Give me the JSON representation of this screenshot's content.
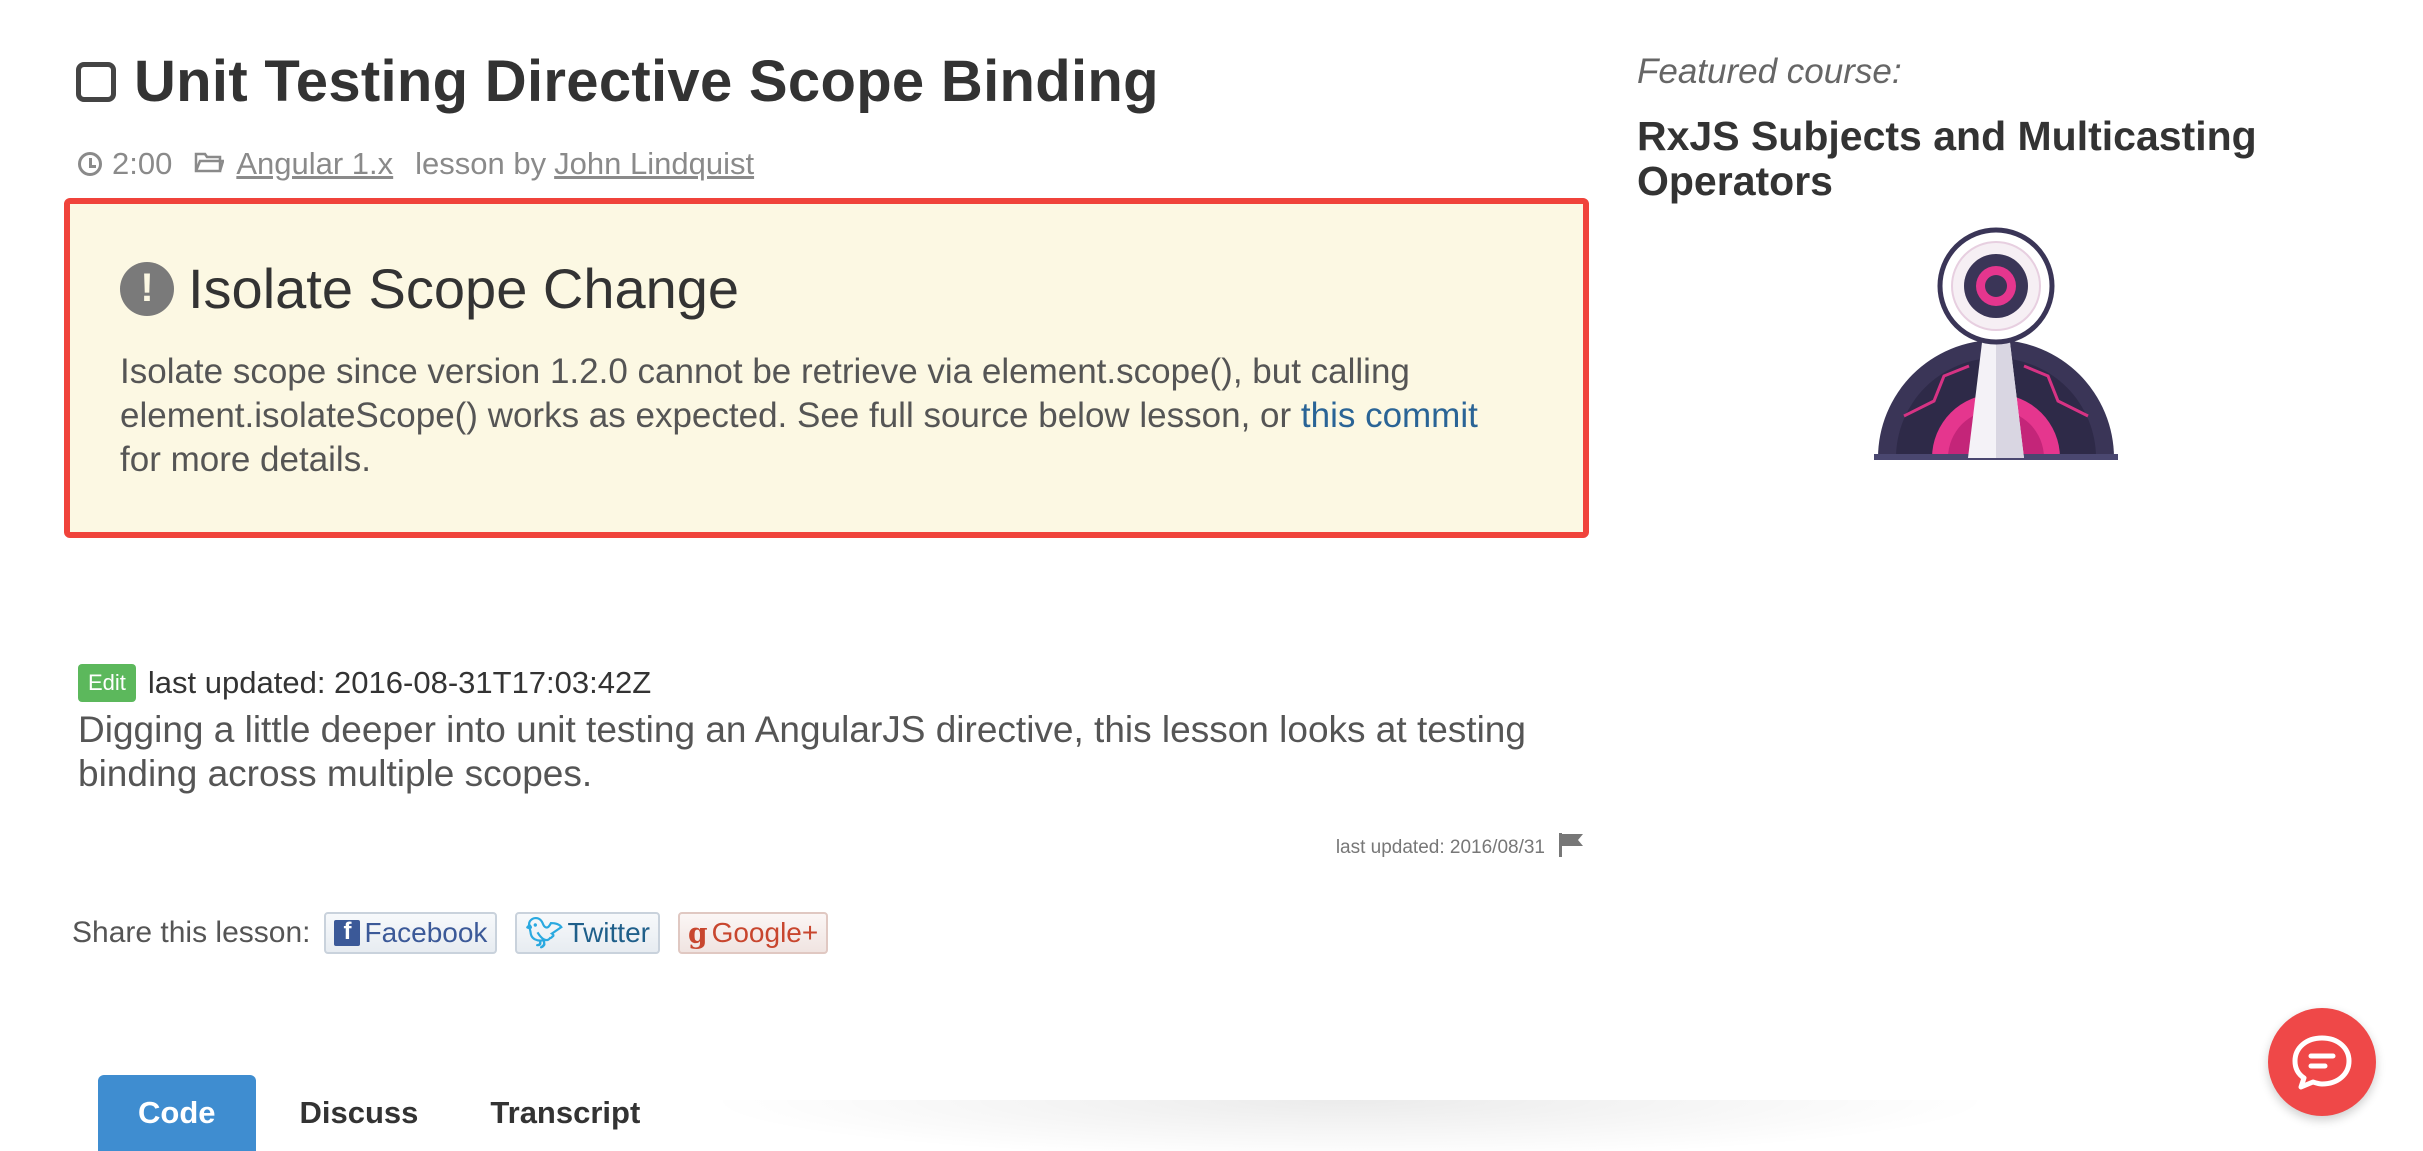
{
  "lesson": {
    "title": "Unit Testing Directive Scope Binding",
    "duration": "2:00",
    "category_link": "Angular 1.x",
    "lesson_by_text": "lesson by",
    "author_link": "John Lindquist"
  },
  "alert": {
    "heading": "Isolate Scope Change",
    "body_before_link": "Isolate scope since version 1.2.0 cannot be retrieve via element.scope(), but calling element.isolateScope() works as expected. See full source below lesson, or ",
    "link_text": "this commit",
    "body_after_link": " for more details.",
    "icon": "exclamation-icon"
  },
  "edit": {
    "badge_label": "Edit",
    "last_updated_text": "last updated: 2016-08-31T17:03:42Z"
  },
  "description": "Digging a little deeper into unit testing an AngularJS directive, this lesson looks at testing binding across multiple scopes.",
  "footer_meta": {
    "last_updated_short": "last updated: 2016/08/31",
    "flag_icon": "flag-icon"
  },
  "share": {
    "label": "Share this lesson:",
    "facebook_label": "Facebook",
    "twitter_label": "Twitter",
    "google_label": "Google+"
  },
  "tabs": [
    {
      "label": "Code",
      "active": true
    },
    {
      "label": "Discuss",
      "active": false
    },
    {
      "label": "Transcript",
      "active": false
    }
  ],
  "sidebar": {
    "featured_label": "Featured course:",
    "featured_title": "RxJS Subjects and Multicasting Operators"
  },
  "colors": {
    "alert_outline": "#f0433b",
    "alert_bg": "#fcf8e3",
    "active_tab": "#3f8dd0",
    "edit_badge": "#5cb85c",
    "chat_button": "#ef4848",
    "link": "#2a6496"
  },
  "chat": {
    "icon": "chat-icon"
  }
}
